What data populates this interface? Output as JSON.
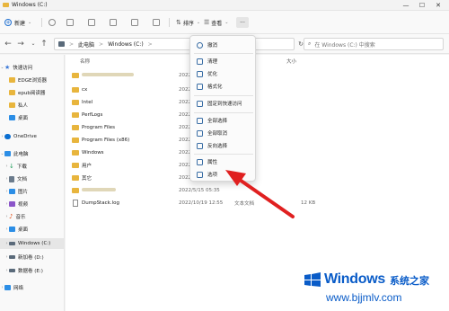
{
  "window": {
    "title": "Windows (C:)",
    "controls": [
      "—",
      "☐",
      "✕"
    ]
  },
  "toolbar": {
    "new_label": "新建",
    "sort_label": "排序",
    "view_label": "查看",
    "more_label": "···"
  },
  "address": {
    "segments": [
      "此电脑",
      ">",
      "Windows (C:)",
      ">"
    ],
    "search_placeholder": "在 Windows (C:) 中搜索"
  },
  "sidebar": {
    "items": [
      {
        "label": "快速访问",
        "icon": "star-icon",
        "color": "#3b78d8"
      },
      {
        "label": "EDGE浏览器",
        "icon": "folder-icon",
        "color": "#e8b53d"
      },
      {
        "label": "epub阅读器",
        "icon": "folder-icon",
        "color": "#e8b53d"
      },
      {
        "label": "私人",
        "icon": "folder-icon",
        "color": "#e8b53d"
      },
      {
        "label": "桌面",
        "icon": "desktop-icon",
        "color": "#2c8ee6"
      },
      {
        "label": "OneDrive",
        "icon": "cloud-icon",
        "color": "#0a6ed1"
      },
      {
        "label": "此电脑",
        "icon": "pc-icon",
        "color": "#2c8ee6"
      },
      {
        "label": "下载",
        "icon": "download-icon",
        "color": "#1e9e5a"
      },
      {
        "label": "文档",
        "icon": "document-icon",
        "color": "#6b7b8c"
      },
      {
        "label": "图片",
        "icon": "picture-icon",
        "color": "#2c8ee6"
      },
      {
        "label": "视频",
        "icon": "video-icon",
        "color": "#8b55c9"
      },
      {
        "label": "音乐",
        "icon": "music-icon",
        "color": "#e2541f"
      },
      {
        "label": "桌面",
        "icon": "desktop-icon",
        "color": "#2c8ee6"
      },
      {
        "label": "Windows (C:)",
        "icon": "drive-icon",
        "color": "#5a6a7a"
      },
      {
        "label": "新加卷 (D:)",
        "icon": "drive-icon",
        "color": "#5a6a7a"
      },
      {
        "label": "数据卷 (E:)",
        "icon": "drive-icon",
        "color": "#5a6a7a"
      },
      {
        "label": "网络",
        "icon": "network-icon",
        "color": "#2c8ee6"
      }
    ]
  },
  "columns": {
    "name": "名称",
    "date": "修改日期",
    "type": "类型",
    "size": "大小"
  },
  "files": [
    {
      "name": "",
      "date": "2022/",
      "type": "",
      "size": "",
      "kind": "folder"
    },
    {
      "name": "cx",
      "date": "2022/",
      "type": "",
      "size": "",
      "kind": "folder"
    },
    {
      "name": "Intel",
      "date": "2022/",
      "type": "",
      "size": "",
      "kind": "folder"
    },
    {
      "name": "PerfLogs",
      "date": "2022/",
      "type": "",
      "size": "",
      "kind": "folder"
    },
    {
      "name": "Program Files",
      "date": "2022/",
      "type": "",
      "size": "",
      "kind": "folder"
    },
    {
      "name": "Program Files (x86)",
      "date": "2022/",
      "type": "",
      "size": "",
      "kind": "folder"
    },
    {
      "name": "Windows",
      "date": "2022/",
      "type": "",
      "size": "",
      "kind": "folder"
    },
    {
      "name": "用户",
      "date": "2022/",
      "type": "",
      "size": "",
      "kind": "folder"
    },
    {
      "name": "其它",
      "date": "2022/",
      "type": "",
      "size": "",
      "kind": "folder"
    },
    {
      "name": "",
      "date": "2022/5/15 05:35",
      "type": "",
      "size": "",
      "kind": "folder"
    },
    {
      "name": "DumpStack.log",
      "date": "2022/10/19 12:55",
      "type": "文本文档",
      "size": "12 KB",
      "kind": "file"
    }
  ],
  "menu": {
    "items": [
      {
        "label": "撤消",
        "icon": "undo-icon"
      },
      {
        "label": "清理",
        "icon": "broom-icon"
      },
      {
        "label": "优化",
        "icon": "optimize-icon"
      },
      {
        "label": "格式化",
        "icon": "format-icon"
      },
      {
        "label": "固定到快速访问",
        "icon": "pin-icon"
      },
      {
        "label": "全部选择",
        "icon": "select-all-icon"
      },
      {
        "label": "全部取消",
        "icon": "select-none-icon"
      },
      {
        "label": "反向选择",
        "icon": "invert-selection-icon"
      },
      {
        "label": "属性",
        "icon": "properties-icon"
      },
      {
        "label": "选项",
        "icon": "options-icon"
      }
    ]
  },
  "annotation": {
    "arrow_color": "#e02020"
  },
  "watermark": {
    "brand": "Windows",
    "brand_cn": "系统之家",
    "url": "www.bjjmlv.com"
  },
  "accent": "#0a5cc8"
}
